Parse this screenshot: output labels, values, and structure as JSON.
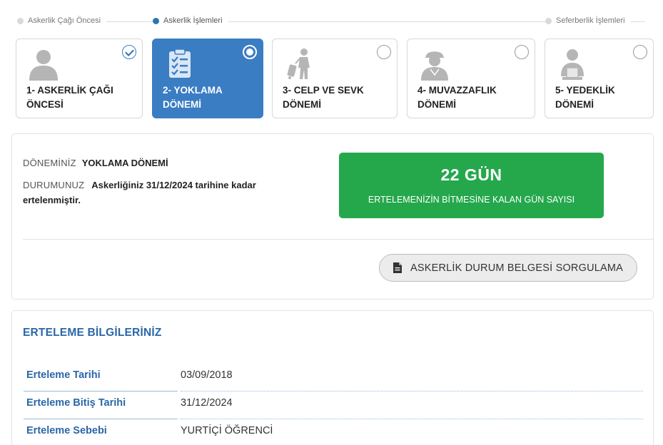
{
  "phases": [
    {
      "label": "Askerlik Çağı Öncesi",
      "active": false
    },
    {
      "label": "Askerlik İşlemleri",
      "active": true
    },
    {
      "label": "Seferberlik İşlemleri",
      "active": false
    }
  ],
  "steps": [
    {
      "line1": "1- ASKERLİK ÇAĞI",
      "line2": "ÖNCESİ",
      "icon": "person-icon",
      "state": "completed"
    },
    {
      "line1": "2- YOKLAMA",
      "line2": "DÖNEMİ",
      "icon": "clipboard-checklist-icon",
      "state": "active"
    },
    {
      "line1": "3- CELP VE SEVK",
      "line2": "DÖNEMİ",
      "icon": "traveler-luggage-icon",
      "state": "pending"
    },
    {
      "line1": "4- MUVAZZAFLIK",
      "line2": "DÖNEMİ",
      "icon": "soldier-icon",
      "state": "pending"
    },
    {
      "line1": "5- YEDEKLİK",
      "line2": "DÖNEMİ",
      "icon": "reserve-person-icon",
      "state": "pending"
    }
  ],
  "status": {
    "term_label": "DÖNEMİNİZ",
    "term_value": "YOKLAMA DÖNEMİ",
    "state_label": "DURUMUNUZ",
    "state_value": "Askerliğiniz 31/12/2024 tarihine kadar ertelenmiştir.",
    "days_count": "22 GÜN",
    "days_caption": "ERTELEMENİZİN BİTMESİNE KALAN GÜN SAYISI",
    "button_label": "ASKERLİK DURUM BELGESİ SORGULAMA"
  },
  "deferral": {
    "title": "ERTELEME BİLGİLERİNİZ",
    "rows": [
      {
        "label": "Erteleme Tarihi",
        "value": "03/09/2018"
      },
      {
        "label": "Erteleme Bitiş Tarihi",
        "value": "31/12/2024"
      },
      {
        "label": "Erteleme Sebebi",
        "value": "YURTİÇİ ÖĞRENCİ"
      }
    ]
  },
  "colors": {
    "accent_blue": "#3a7dc3",
    "title_blue": "#2a67a8",
    "success_green": "#24a84b",
    "icon_gray": "#b5b5b5"
  }
}
